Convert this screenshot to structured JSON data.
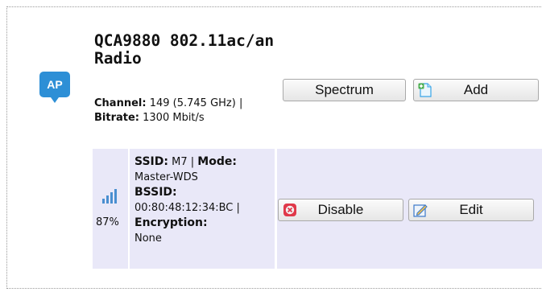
{
  "radio": {
    "badge": "AP",
    "title": "QCA9880 802.11ac/an Radio",
    "channel_label": "Channel:",
    "channel_value": "149 (5.745 GHz)",
    "separator": "|",
    "bitrate_label": "Bitrate:",
    "bitrate_value": "1300 Mbit/s"
  },
  "buttons": {
    "spectrum": "Spectrum",
    "add": "Add",
    "disable": "Disable",
    "edit": "Edit"
  },
  "network": {
    "signal_percent": "87%",
    "signal_level": 0.87,
    "ssid_label": "SSID:",
    "ssid_value": "M7",
    "mode_label": "Mode:",
    "mode_value": "Master-WDS",
    "bssid_label": "BSSID:",
    "bssid_value": "00:80:48:12:34:BC",
    "encryption_label": "Encryption:",
    "encryption_value": "None"
  },
  "colors": {
    "badge": "#2d8fd6",
    "row_bg": "#e9e8f8",
    "signal_bars": "#4a8fd0",
    "disable_icon": "#e0394a",
    "add_icon": "#38a5e8",
    "edit_icon": "#3b77c9"
  },
  "icons": {
    "ap": "access-point-icon",
    "signal": "signal-strength-icon",
    "add": "add-document-icon",
    "disable": "disable-icon",
    "edit": "edit-icon"
  }
}
